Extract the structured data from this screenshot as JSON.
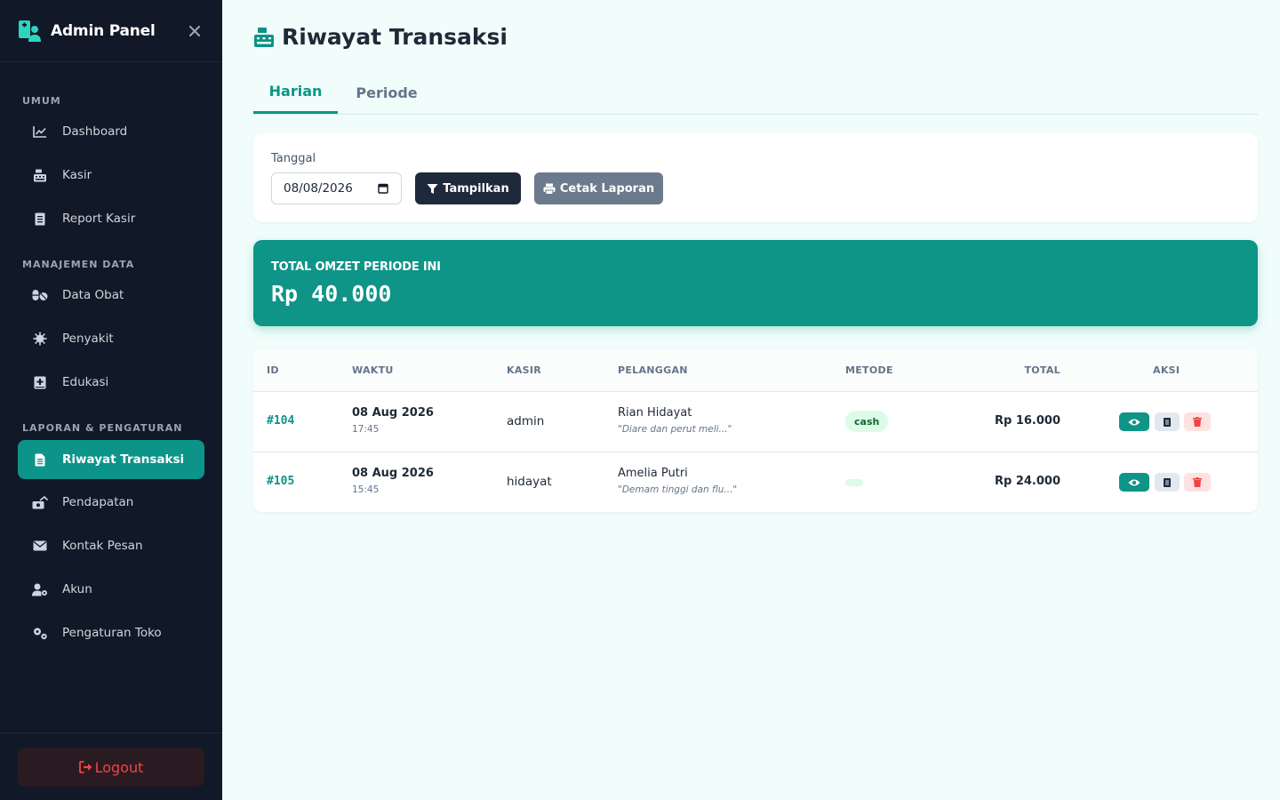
{
  "sidebar": {
    "brand": "Admin Panel",
    "sections": {
      "umum": "UMUM",
      "manajemen": "MANAJEMEN DATA",
      "laporan": "LAPORAN & PENGATURAN"
    },
    "items": {
      "dashboard": "Dashboard",
      "kasir": "Kasir",
      "report_kasir": "Report Kasir",
      "data_obat": "Data Obat",
      "penyakit": "Penyakit",
      "edukasi": "Edukasi",
      "riwayat": "Riwayat Transaksi",
      "pendapatan": "Pendapatan",
      "kontak": "Kontak Pesan",
      "akun": "Akun",
      "pengaturan": "Pengaturan Toko"
    },
    "logout": "Logout"
  },
  "page": {
    "title": "Riwayat Transaksi",
    "tabs": [
      "Harian",
      "Periode"
    ]
  },
  "filter": {
    "label": "Tanggal",
    "date_value": "08/08/2026",
    "show_button": "Tampilkan",
    "print_button": "Cetak Laporan"
  },
  "omzet": {
    "label": "TOTAL OMZET PERIODE INI",
    "value": "Rp 40.000"
  },
  "table": {
    "headers": [
      "ID",
      "WAKTU",
      "KASIR",
      "PELANGGAN",
      "METODE",
      "TOTAL",
      "AKSI"
    ],
    "rows": [
      {
        "id": "#104",
        "date": "08 Aug 2026",
        "time": "17:45",
        "kasir": "admin",
        "customer": "Rian Hidayat",
        "note": "\"Diare dan perut meli...\"",
        "method": "cash",
        "total": "Rp 16.000"
      },
      {
        "id": "#105",
        "date": "08 Aug 2026",
        "time": "15:45",
        "kasir": "hidayat",
        "customer": "Amelia Putri",
        "note": "\"Demam tinggi dan flu...\"",
        "method": "",
        "total": "Rp 24.000"
      }
    ]
  },
  "colors": {
    "accent": "#0d9488",
    "sidebar_bg": "#111827",
    "page_bg": "#f0fdfa",
    "danger": "#ef4444"
  }
}
